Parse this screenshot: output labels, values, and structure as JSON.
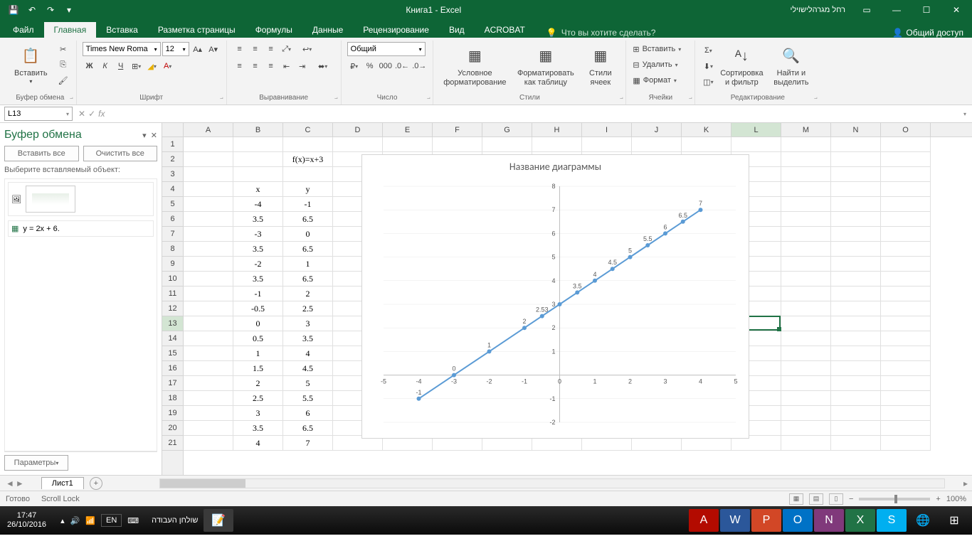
{
  "titlebar": {
    "doc_title": "Книга1 - Excel",
    "user": "רחל מגרהלישוילי"
  },
  "tabs": {
    "file": "Файл",
    "home": "Главная",
    "insert": "Вставка",
    "layout": "Разметка страницы",
    "formulas": "Формулы",
    "data": "Данные",
    "review": "Рецензирование",
    "view": "Вид",
    "acrobat": "ACROBAT",
    "tellme": "Что вы хотите сделать?",
    "share": "Общий доступ"
  },
  "ribbon": {
    "clipboard": {
      "paste": "Вставить",
      "label": "Буфер обмена"
    },
    "font": {
      "name": "Times New Roma",
      "size": "12",
      "label": "Шрифт"
    },
    "align": {
      "label": "Выравнивание"
    },
    "number": {
      "format": "Общий",
      "label": "Число"
    },
    "styles": {
      "cond": "Условное форматирование",
      "table": "Форматировать как таблицу",
      "cell": "Стили ячеек",
      "label": "Стили"
    },
    "cells": {
      "insert": "Вставить",
      "delete": "Удалить",
      "format": "Формат",
      "label": "Ячейки"
    },
    "editing": {
      "sort": "Сортировка и фильтр",
      "find": "Найти и выделить",
      "label": "Редактирование"
    }
  },
  "name_box": "L13",
  "clipboard_pane": {
    "title": "Буфер обмена",
    "paste_all": "Вставить все",
    "clear_all": "Очистить все",
    "hint": "Выберите вставляемый объект:",
    "item2": "y = 2x + 6.",
    "options": "Параметры"
  },
  "columns": [
    "A",
    "B",
    "C",
    "D",
    "E",
    "F",
    "G",
    "H",
    "I",
    "J",
    "K",
    "L",
    "M",
    "N",
    "O"
  ],
  "rows": [
    1,
    2,
    3,
    4,
    5,
    6,
    7,
    8,
    9,
    10,
    11,
    12,
    13,
    14,
    15,
    16,
    17,
    18,
    19,
    20,
    21
  ],
  "cells": {
    "C2": "f(x)=x+3",
    "B4": "x",
    "C4": "y",
    "B5": "-4",
    "C5": "-1",
    "B6": "3.5",
    "C6": "6.5",
    "B7": "-3",
    "C7": "0",
    "B8": "3.5",
    "C8": "6.5",
    "B9": "-2",
    "C9": "1",
    "B10": "3.5",
    "C10": "6.5",
    "B11": "-1",
    "C11": "2",
    "B12": "-0.5",
    "C12": "2.5",
    "B13": "0",
    "C13": "3",
    "B14": "0.5",
    "C14": "3.5",
    "B15": "1",
    "C15": "4",
    "B16": "1.5",
    "C16": "4.5",
    "B17": "2",
    "C17": "5",
    "B18": "2.5",
    "C18": "5.5",
    "B19": "3",
    "C19": "6",
    "B20": "3.5",
    "C20": "6.5",
    "B21": "4",
    "C21": "7"
  },
  "chart_data": {
    "type": "line",
    "title": "Название диаграммы",
    "xlabel": "",
    "ylabel": "",
    "xlim": [
      -5,
      5
    ],
    "ylim": [
      -2,
      8
    ],
    "xticks": [
      -5,
      -4,
      -3,
      -2,
      -1,
      0,
      1,
      2,
      3,
      4,
      5
    ],
    "yticks": [
      -2,
      -1,
      0,
      1,
      2,
      3,
      4,
      5,
      6,
      7,
      8
    ],
    "series": [
      {
        "name": "y",
        "x": [
          -4,
          -3,
          -2,
          -1,
          -0.5,
          0,
          0.5,
          1,
          1.5,
          2,
          2.5,
          3,
          3.5,
          4
        ],
        "y": [
          -1,
          0,
          1,
          2,
          2.5,
          3,
          3.5,
          4,
          4.5,
          5,
          5.5,
          6,
          6.5,
          7
        ],
        "labels": [
          "-1",
          "0",
          "1",
          "2",
          "2.53",
          "",
          "3.5",
          "4",
          "4.5",
          "5",
          "5.5",
          "6",
          "6.5",
          "7"
        ]
      }
    ]
  },
  "sheet": {
    "name": "Лист1"
  },
  "status": {
    "ready": "Готово",
    "scroll": "Scroll Lock",
    "zoom": "100%"
  },
  "taskbar": {
    "time": "17:47",
    "date": "26/10/2016",
    "lang": "EN",
    "desktop": "שולחן העבודה"
  }
}
